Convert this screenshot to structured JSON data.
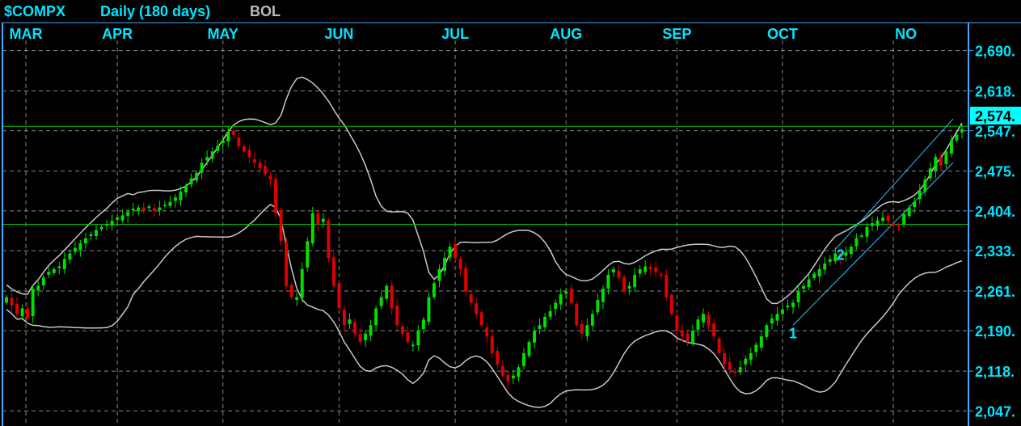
{
  "header": {
    "symbol": "$COMPX",
    "period": "Daily (180 days)",
    "indicator": "BOL"
  },
  "colors": {
    "background": "#000000",
    "grid": "#aaaaaa",
    "axis": "#3fa8ff",
    "label": "#00e5ff",
    "up": "#00e000",
    "down": "#e00000",
    "bands": "#c8c8c8",
    "hline": "#00c000",
    "channel": "#22c8ff",
    "price_box": "#00ffff"
  },
  "chart_data": {
    "type": "candlestick",
    "title": "$COMPX",
    "ylim": [
      2020,
      2740
    ],
    "y_ticks": [
      {
        "value": 2690,
        "label": "2,690."
      },
      {
        "value": 2618,
        "label": "2,618."
      },
      {
        "value": 2547,
        "label": "2,547."
      },
      {
        "value": 2475,
        "label": "2,475."
      },
      {
        "value": 2404,
        "label": "2,404."
      },
      {
        "value": 2333,
        "label": "2,333."
      },
      {
        "value": 2261,
        "label": "2,261."
      },
      {
        "value": 2190,
        "label": "2,190."
      },
      {
        "value": 2118,
        "label": "2,118."
      },
      {
        "value": 2047,
        "label": "2,047."
      }
    ],
    "months": [
      "MAR",
      "APR",
      "MAY",
      "JUN",
      "JUL",
      "AUG",
      "SEP",
      "OCT",
      "NO"
    ],
    "current_price_label": "2,574.",
    "current_price": 2574,
    "horizontal_lines": [
      2555,
      2380
    ],
    "annotations": [
      {
        "label": "1",
        "index": 149,
        "price": 2185
      },
      {
        "label": "2",
        "index": 158,
        "price": 2325
      }
    ],
    "close": [
      2250,
      2235,
      2220,
      2230,
      2212,
      2265,
      2270,
      2285,
      2295,
      2300,
      2305,
      2318,
      2328,
      2338,
      2346,
      2355,
      2362,
      2370,
      2375,
      2380,
      2386,
      2392,
      2396,
      2402,
      2408,
      2410,
      2405,
      2412,
      2404,
      2410,
      2415,
      2420,
      2428,
      2438,
      2448,
      2462,
      2472,
      2490,
      2500,
      2510,
      2520,
      2530,
      2545,
      2540,
      2520,
      2510,
      2500,
      2490,
      2480,
      2470,
      2460,
      2400,
      2350,
      2270,
      2250,
      2250,
      2300,
      2350,
      2400,
      2380,
      2390,
      2320,
      2270,
      2230,
      2200,
      2210,
      2185,
      2170,
      2185,
      2200,
      2230,
      2250,
      2270,
      2230,
      2200,
      2185,
      2170,
      2165,
      2190,
      2210,
      2250,
      2275,
      2300,
      2320,
      2340,
      2320,
      2300,
      2260,
      2240,
      2220,
      2200,
      2180,
      2150,
      2130,
      2110,
      2100,
      2110,
      2125,
      2150,
      2170,
      2190,
      2200,
      2215,
      2225,
      2240,
      2255,
      2260,
      2240,
      2200,
      2185,
      2200,
      2220,
      2245,
      2265,
      2290,
      2300,
      2285,
      2260,
      2270,
      2290,
      2300,
      2305,
      2300,
      2295,
      2290,
      2250,
      2220,
      2190,
      2180,
      2170,
      2190,
      2210,
      2220,
      2200,
      2180,
      2150,
      2130,
      2120,
      2115,
      2125,
      2140,
      2150,
      2165,
      2180,
      2200,
      2212,
      2220,
      2228,
      2235,
      2240,
      2260,
      2270,
      2282,
      2292,
      2300,
      2310,
      2318,
      2328,
      2320,
      2330,
      2340,
      2355,
      2360,
      2375,
      2382,
      2387,
      2392,
      2386,
      2378,
      2376,
      2398,
      2410,
      2420,
      2440,
      2460,
      2480,
      2500,
      2485,
      2510,
      2530,
      2540,
      2550
    ],
    "bollinger": {
      "period": 20,
      "stdev": 2
    }
  }
}
